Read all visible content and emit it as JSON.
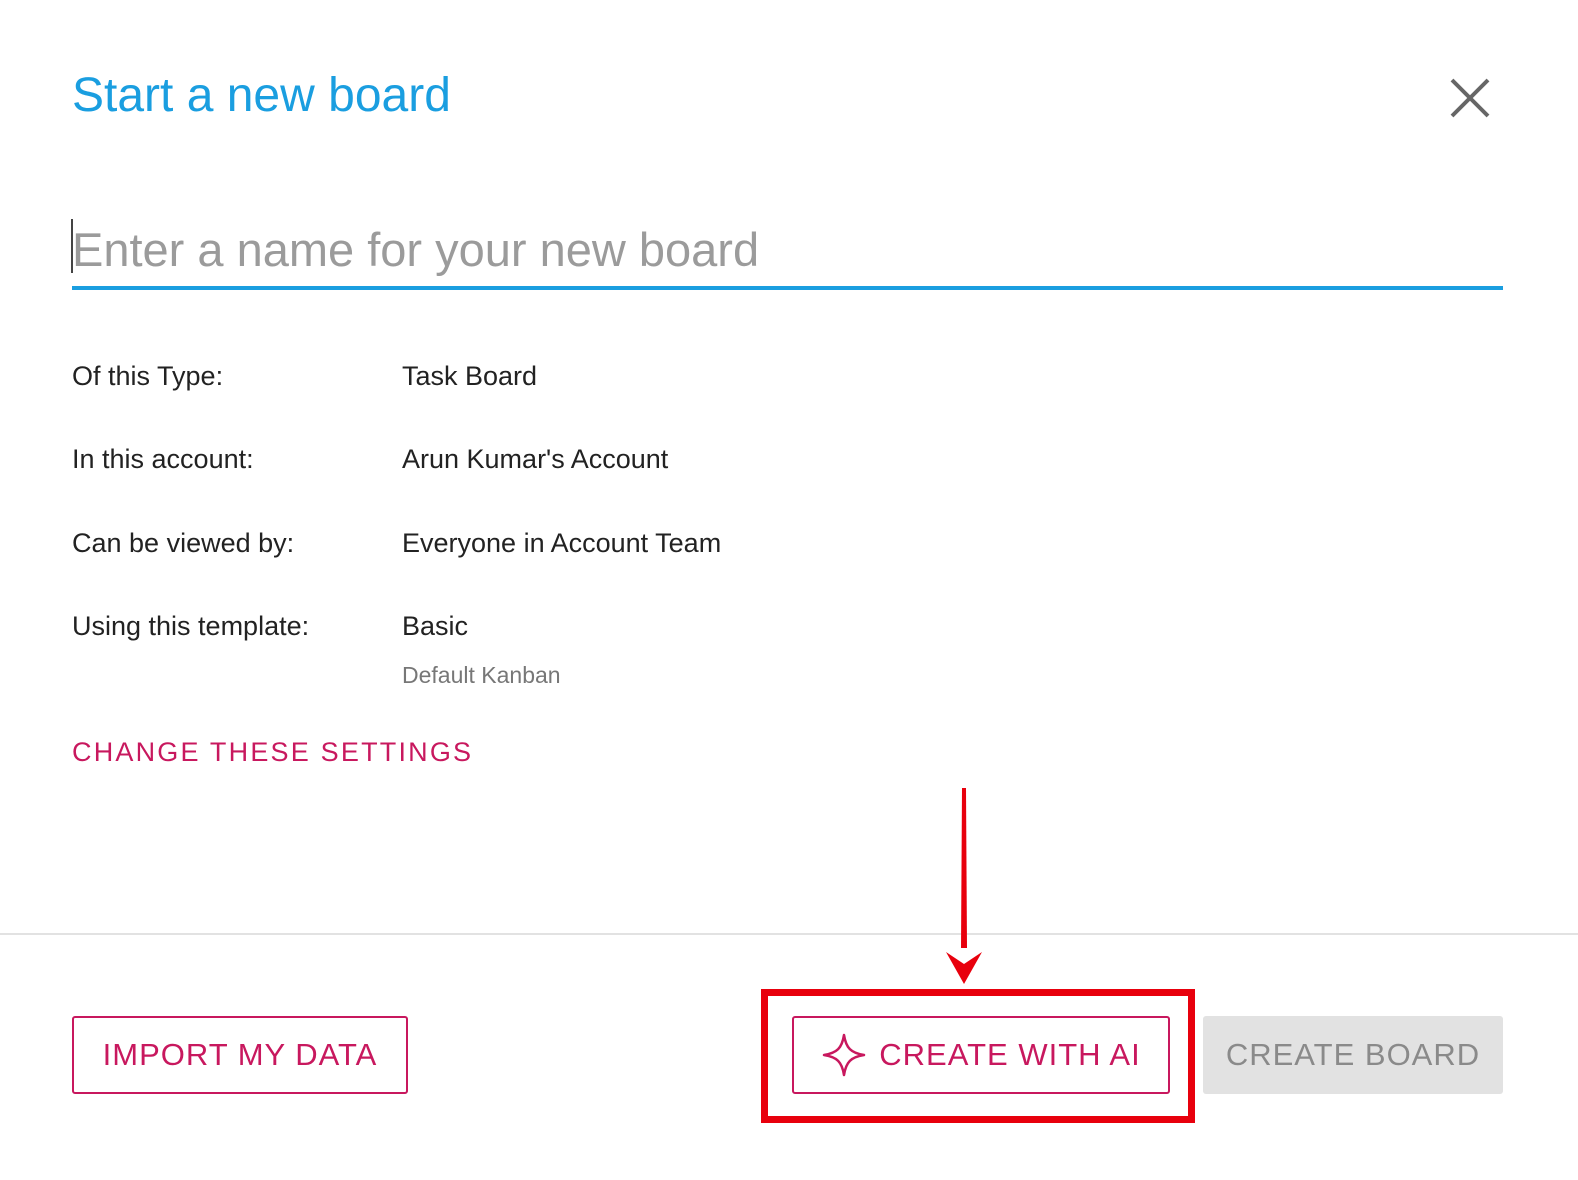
{
  "dialog": {
    "title": "Start a new board",
    "name_input": {
      "placeholder": "Enter a name for your new board",
      "value": ""
    },
    "settings": [
      {
        "label": "Of this Type:",
        "value": "Task Board"
      },
      {
        "label": "In this account:",
        "value": "Arun Kumar's Account"
      },
      {
        "label": "Can be viewed by:",
        "value": "Everyone in Account Team"
      },
      {
        "label": "Using this template:",
        "value": "Basic",
        "sub": "Default Kanban"
      }
    ],
    "change_settings_label": "CHANGE THESE SETTINGS"
  },
  "footer": {
    "import_label": "IMPORT MY DATA",
    "create_ai_label": "CREATE WITH AI",
    "create_board_label": "CREATE BOARD"
  },
  "colors": {
    "accent_blue": "#1a9ee0",
    "accent_magenta": "#c8185e",
    "annotation_red": "#e8000d",
    "disabled_bg": "#e2e2e2"
  },
  "icons": [
    "close-icon",
    "sparkle-icon",
    "annotation-arrow"
  ]
}
